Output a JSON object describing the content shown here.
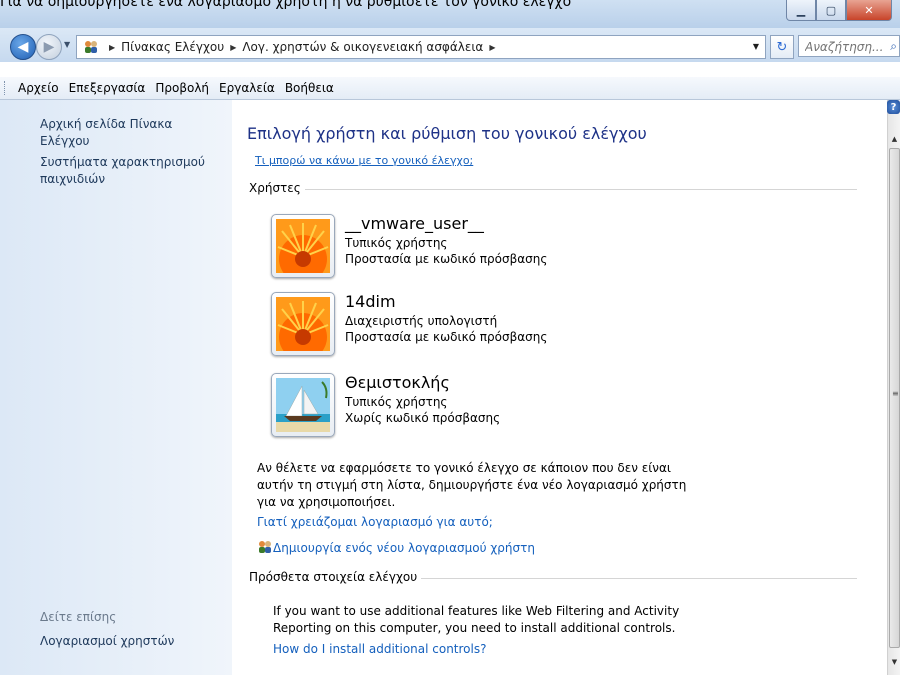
{
  "window": {
    "title_fragment": "Για να δημιουργήσετε ένα λογαριασμό χρήστη ή να ρυθμίσετε τον γονικό έλεγχο"
  },
  "address": {
    "crumbs": [
      "Πίνακας Ελέγχου",
      "Λογ. χρηστών & οικογενειακή ασφάλεια"
    ],
    "search_placeholder": "Αναζήτηση..."
  },
  "menu": {
    "items": [
      "Αρχείο",
      "Επεξεργασία",
      "Προβολή",
      "Εργαλεία",
      "Βοήθεια"
    ]
  },
  "sidebar": {
    "home": "Αρχική σελίδα Πίνακα Ελέγχου",
    "game_ratings": "Συστήματα χαρακτηρισμού παιχνιδιών",
    "see_also": "Δείτε επίσης",
    "user_accounts": "Λογαριασμοί χρηστών"
  },
  "main": {
    "heading": "Επιλογή χρήστη και ρύθμιση του γονικού ελέγχου",
    "help_link": "Τι μπορώ να κάνω με το γονικό έλεγχο;",
    "users_group": "Χρήστες",
    "users": [
      {
        "name": "__vmware_user__",
        "type": "Τυπικός χρήστης",
        "password": "Προστασία με κωδικό πρόσβασης",
        "picture": "flower"
      },
      {
        "name": "14dim",
        "type": "Διαχειριστής υπολογιστή",
        "password": "Προστασία με κωδικό πρόσβασης",
        "picture": "flower"
      },
      {
        "name": "Θεμιστοκλής",
        "type": "Τυπικός χρήστης",
        "password": "Χωρίς κωδικό πρόσβασης",
        "picture": "sailboat"
      }
    ],
    "paragraph": "Αν θέλετε να εφαρμόσετε το γονικό έλεγχο σε κάποιον που δεν είναι αυτήν τη στιγμή στη λίστα, δημιουργήστε ένα νέο λογαριασμό χρήστη για να χρησιμοποιήσει.",
    "why_link": "Γιατί χρειάζομαι λογαριασμό για αυτό;",
    "create_link": "Δημιουργία ενός νέου λογαριασμού χρήστη",
    "extra_group": "Πρόσθετα στοιχεία ελέγχου",
    "extra_text": "If you want to use additional features like Web Filtering and Activity Reporting on this computer, you need to install additional controls.",
    "install_link": "How do I install additional controls?"
  },
  "colors": {
    "heading": "#1e3287",
    "link": "#1560bd",
    "sidebar_bg": "#dce8f6"
  }
}
